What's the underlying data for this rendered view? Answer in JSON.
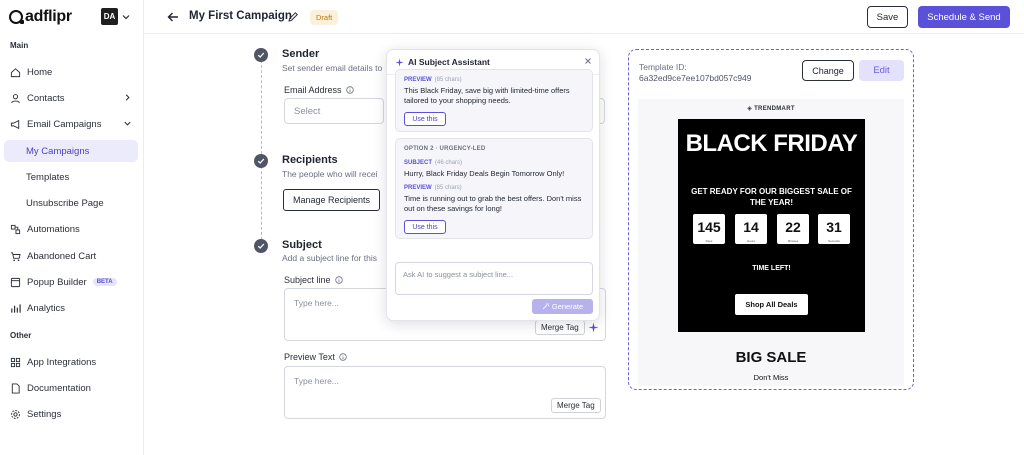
{
  "brand": {
    "name": "adflipr"
  },
  "account": {
    "initials": "DA"
  },
  "sidebar": {
    "main_label": "Main",
    "other_label": "Other",
    "items": {
      "home": "Home",
      "contacts": "Contacts",
      "email_campaigns": "Email Campaigns",
      "my_campaigns": "My Campaigns",
      "templates": "Templates",
      "unsubscribe": "Unsubscribe Page",
      "automations": "Automations",
      "abandoned_cart": "Abandoned Cart",
      "popup_builder": "Popup Builder",
      "popup_badge": "BETA",
      "analytics": "Analytics",
      "app_integrations": "App Integrations",
      "documentation": "Documentation",
      "settings": "Settings"
    }
  },
  "header": {
    "title": "My First Campaign",
    "status": "Draft",
    "save_label": "Save",
    "schedule_label": "Schedule & Send"
  },
  "form": {
    "sender": {
      "title": "Sender",
      "desc": "Set sender email details to"
    },
    "email_address": {
      "label": "Email Address",
      "placeholder": "Select"
    },
    "recipients": {
      "title": "Recipients",
      "desc": "The people who will recei",
      "button": "Manage Recipients"
    },
    "subject": {
      "title": "Subject",
      "desc": "Add a subject line for this"
    },
    "subject_line": {
      "label": "Subject line",
      "placeholder": "Type here...",
      "merge_tag": "Merge Tag"
    },
    "preview_text": {
      "label": "Preview Text",
      "placeholder": "Type here...",
      "merge_tag": "Merge Tag"
    }
  },
  "ai_panel": {
    "title": "AI Subject Assistant",
    "option1": {
      "preview_label": "PREVIEW",
      "preview_count": "(85 chars)",
      "preview_text": "This Black Friday, save big with limited-time offers tailored to your shopping needs.",
      "use_label": "Use this"
    },
    "option2": {
      "name": "OPTION 2 · URGENCY-LED",
      "subject_label": "SUBJECT",
      "subject_count": "(46 chars)",
      "subject_text": "Hurry, Black Friday Deals Begin Tomorrow Only!",
      "preview_label": "PREVIEW",
      "preview_count": "(85 chars)",
      "preview_text": "Time is running out to grab the best offers. Don't miss out on these savings for long!",
      "use_label": "Use this"
    },
    "input_placeholder": "Ask AI to suggest a subject line...",
    "generate_label": "Generate"
  },
  "template": {
    "id_label": "Template ID:",
    "id_value": "6a32ed9ce7ee107bd057c949",
    "change_label": "Change",
    "edit_label": "Edit",
    "brand": "TRENDMART",
    "headline": "BLACK FRIDAY",
    "subhead": "GET READY FOR OUR BIGGEST SALE OF THE YEAR!",
    "countdown": [
      {
        "value": "145",
        "unit": "Days"
      },
      {
        "value": "14",
        "unit": "Hours"
      },
      {
        "value": "22",
        "unit": "Minutes"
      },
      {
        "value": "31",
        "unit": "Seconds"
      }
    ],
    "time_left": "TIME LEFT!",
    "cta": "Shop All Deals",
    "big_sale": "BIG SALE",
    "dont_miss": "Don't Miss"
  },
  "colors": {
    "accent": "#5b50d8",
    "draft_bg": "#fbf0d9",
    "draft_text": "#b27a1c"
  }
}
